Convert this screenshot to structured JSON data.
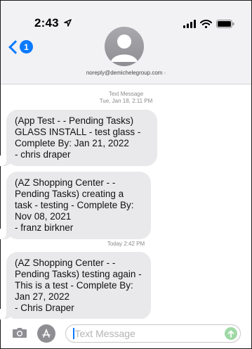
{
  "status_bar": {
    "time": "2:43",
    "location_arrow": "location-arrow-icon",
    "icons": [
      "signal-icon",
      "wifi-icon",
      "battery-icon"
    ]
  },
  "nav": {
    "back_icon": "chevron-left-icon",
    "unread_count": "1",
    "contact": "noreply@demichelegroup.com",
    "contact_chevron": "›"
  },
  "thread": {
    "section1_label": "Text Message",
    "section1_time": "Tue, Jan 18, 2:11 PM",
    "section2_time": "Today 2:42 PM",
    "messages": [
      {
        "text": "(App Test -  - Pending Tasks) GLASS INSTALL - test glass - Complete By: Jan 21, 2022\n - chris draper"
      },
      {
        "text": "(AZ Shopping Center -  - Pending Tasks) creating a task - testing - Complete By: Nov 08, 2021\n - franz birkner"
      },
      {
        "text": "(AZ Shopping Center -  - Pending Tasks) testing again - This is a test - Complete By: Jan 27, 2022\n - Chris Draper"
      }
    ]
  },
  "composer": {
    "placeholder": "Text Message",
    "camera_icon": "camera-icon",
    "apps_icon": "app-store-icon",
    "send_icon": "send-arrow-icon"
  },
  "colors": {
    "accent": "#0a7aff",
    "bubble": "#e9e9eb",
    "header_bg": "#f2f2f4",
    "send": "#9fd9a6"
  }
}
